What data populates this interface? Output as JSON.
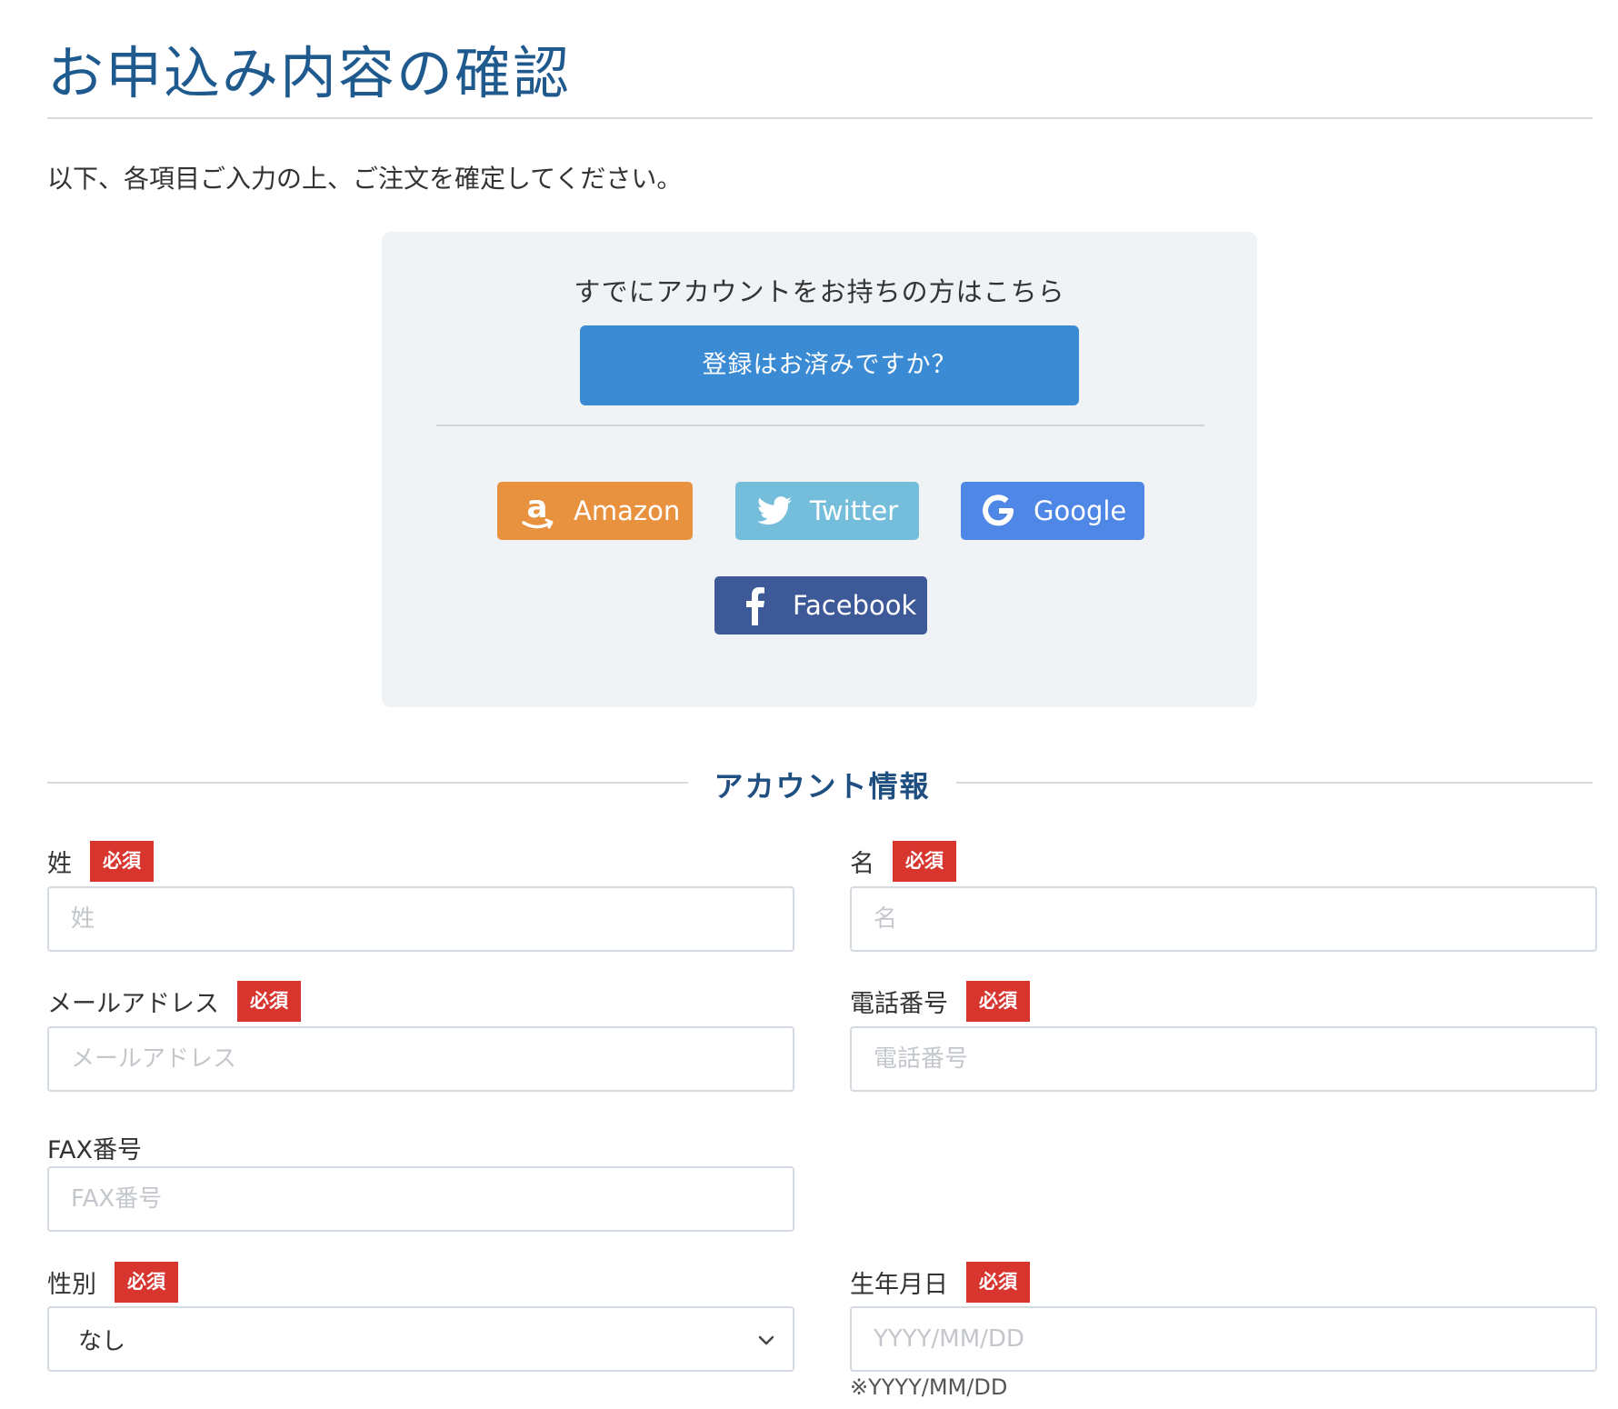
{
  "page": {
    "title": "お申込み内容の確認",
    "intro": "以下、各項目ご入力の上、ご注文を確定してください。"
  },
  "login": {
    "heading": "すでにアカウントをお持ちの方はこちら",
    "register_button": "登録はお済みですか？",
    "social": {
      "amazon": "Amazon",
      "twitter": "Twitter",
      "google": "Google",
      "facebook": "Facebook"
    }
  },
  "section": {
    "account_title": "アカウント情報"
  },
  "required_badge": "必須",
  "fields": {
    "last_name": {
      "label": "姓",
      "placeholder": "姓"
    },
    "first_name": {
      "label": "名",
      "placeholder": "名"
    },
    "email": {
      "label": "メールアドレス",
      "placeholder": "メールアドレス"
    },
    "phone": {
      "label": "電話番号",
      "placeholder": "電話番号"
    },
    "fax": {
      "label": "FAX番号",
      "placeholder": "FAX番号"
    },
    "gender": {
      "label": "性別",
      "selected": "なし"
    },
    "birthdate": {
      "label": "生年月日",
      "placeholder": "YYYY/MM/DD",
      "hint": "※YYYY/MM/DD"
    }
  },
  "colors": {
    "title": "#1f5a8f",
    "primary_button": "#3a8ad4",
    "amazon": "#e8913e",
    "twitter": "#74bedc",
    "google": "#4f87e6",
    "facebook": "#3e5998",
    "required": "#d7352e"
  },
  "icons": {
    "amazon": "amazon-logo-icon",
    "twitter": "twitter-bird-icon",
    "google": "google-g-icon",
    "facebook": "facebook-f-icon",
    "select": "chevron-down-icon"
  }
}
